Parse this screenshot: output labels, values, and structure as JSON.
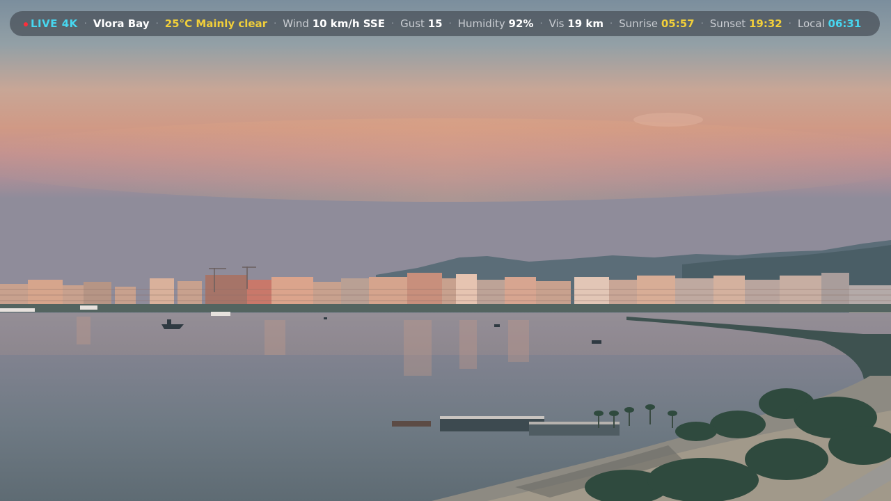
{
  "overlay": {
    "live_label": "LIVE 4K",
    "location": "Vlora Bay",
    "conditions": "25°C Mainly clear",
    "wind_label": "Wind",
    "wind_value": "10 km/h SSE",
    "gust_label": "Gust",
    "gust_value": "15",
    "humidity_label": "Humidity",
    "humidity_value": "92%",
    "vis_label": "Vis",
    "vis_value": "19 km",
    "sunrise_label": "Sunrise",
    "sunrise_value": "05:57",
    "sunset_label": "Sunset",
    "sunset_value": "19:32",
    "local_label": "Local",
    "local_value": "06:31",
    "separator": "·"
  },
  "colors": {
    "live_accent": "#47d7f0",
    "condition_accent": "#f1cf3a",
    "live_dot": "#ff2d3a"
  }
}
